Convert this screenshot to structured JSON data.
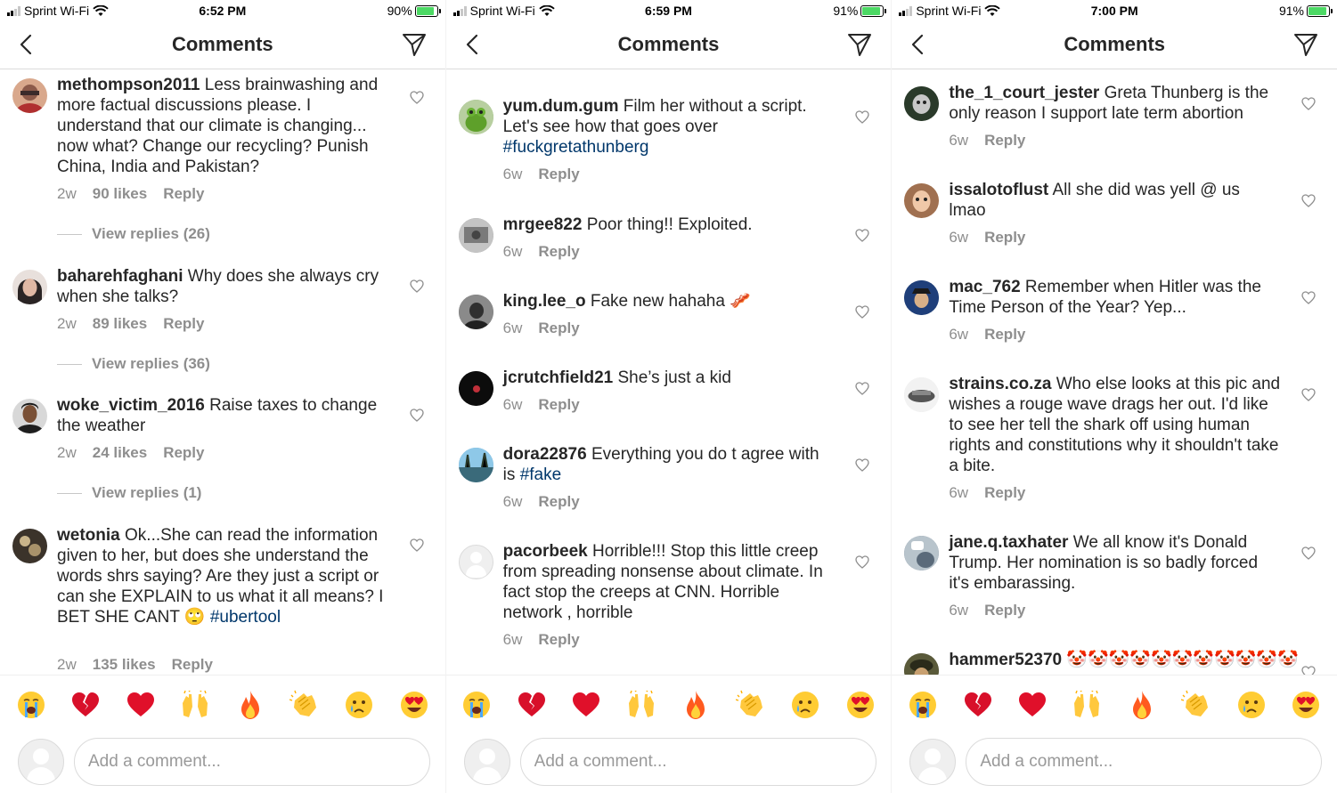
{
  "screens": [
    {
      "status": {
        "carrier": "Sprint Wi-Fi",
        "time": "6:52 PM",
        "battery": "90%",
        "battery_level": 0.9
      },
      "header": {
        "title": "Comments"
      },
      "comments": [
        {
          "username": "methompson2011",
          "text": "Less brainwashing and more factual discussions please. I understand that our climate is changing... now what? Change our recycling? Punish China, India and Pakistan?",
          "age": "2w",
          "likes": "90 likes",
          "reply": "Reply",
          "view_replies": "View replies (26)"
        },
        {
          "username": "baharehfaghani",
          "text": "Why does she always cry when she talks?",
          "age": "2w",
          "likes": "89 likes",
          "reply": "Reply",
          "view_replies": "View replies (36)"
        },
        {
          "username": "woke_victim_2016",
          "text": "Raise taxes to change the weather",
          "age": "2w",
          "likes": "24 likes",
          "reply": "Reply",
          "view_replies": "View replies (1)"
        },
        {
          "username": "wetonia",
          "text": "Ok...She can read the information given to her, but does she understand the words shrs saying? Are they just a script or can she EXPLAIN to us what it all means? I BET SHE CANT 🙄",
          "hashtag": "#ubertool",
          "age": "2w",
          "likes": "135 likes",
          "reply": "Reply"
        }
      ],
      "input": {
        "placeholder": "Add a comment..."
      }
    },
    {
      "status": {
        "carrier": "Sprint Wi-Fi",
        "time": "6:59 PM",
        "battery": "91%",
        "battery_level": 0.91
      },
      "header": {
        "title": "Comments"
      },
      "comments": [
        {
          "username": "yum.dum.gum",
          "text": "Film her without a script. Let's see how that goes over",
          "hashtag": "#fuckgretathunberg",
          "age": "6w",
          "reply": "Reply"
        },
        {
          "username": "mrgee822",
          "text": "Poor thing!! Exploited.",
          "age": "6w",
          "reply": "Reply"
        },
        {
          "username": "king.lee_o",
          "text": "Fake new hahaha 🥓",
          "age": "6w",
          "reply": "Reply"
        },
        {
          "username": "jcrutchfield21",
          "text": "She’s just a kid",
          "age": "6w",
          "reply": "Reply"
        },
        {
          "username": "dora22876",
          "text": "Everything you do t agree with is",
          "hashtag": "#fake",
          "age": "6w",
          "reply": "Reply"
        },
        {
          "username": "pacorbeek",
          "text": "Horrible!!! Stop this little creep from spreading nonsense about climate. In fact stop the creeps at CNN. Horrible network , horrible",
          "age": "6w",
          "reply": "Reply"
        }
      ],
      "input": {
        "placeholder": "Add a comment..."
      }
    },
    {
      "status": {
        "carrier": "Sprint Wi-Fi",
        "time": "7:00 PM",
        "battery": "91%",
        "battery_level": 0.91
      },
      "header": {
        "title": "Comments"
      },
      "comments": [
        {
          "username": "the_1_court_jester",
          "text": "Greta Thunberg is the only reason I support late term abortion",
          "age": "6w",
          "reply": "Reply"
        },
        {
          "username": "issalotoflust",
          "text": "All she did was yell @ us lmao",
          "age": "6w",
          "reply": "Reply"
        },
        {
          "username": "mac_762",
          "text": "Remember when Hitler was the Time Person of the Year?  Yep...",
          "age": "6w",
          "reply": "Reply"
        },
        {
          "username": "strains.co.za",
          "text": "Who else looks at this pic and wishes a rouge wave drags her out. I'd like to see her tell the shark off using human rights and constitutions why it shouldn't take a bite.",
          "age": "6w",
          "reply": "Reply"
        },
        {
          "username": "jane.q.taxhater",
          "text": "We all know it's Donald Trump. Her nomination is so badly forced it's embarassing.",
          "age": "6w",
          "reply": "Reply"
        },
        {
          "username": "hammer52370",
          "text": "🤡🤡🤡🤡🤡🤡🤡🤡🤡🤡🤡"
        }
      ],
      "input": {
        "placeholder": "Add a comment..."
      }
    }
  ],
  "emoji_bar": [
    {
      "name": "loudly-crying-face",
      "glyph": "😭"
    },
    {
      "name": "broken-heart",
      "glyph": "💔"
    },
    {
      "name": "red-heart",
      "glyph": "❤️"
    },
    {
      "name": "raising-hands",
      "glyph": "🙌"
    },
    {
      "name": "fire",
      "glyph": "🔥"
    },
    {
      "name": "clapping-hands",
      "glyph": "👏"
    },
    {
      "name": "crying-face",
      "glyph": "😢"
    },
    {
      "name": "heart-eyes",
      "glyph": "😍"
    }
  ],
  "colors": {
    "hashtag": "#00376b",
    "meta": "#8e8e8e",
    "divider": "#dbdbdb",
    "battery_fill": "#4cd964"
  }
}
